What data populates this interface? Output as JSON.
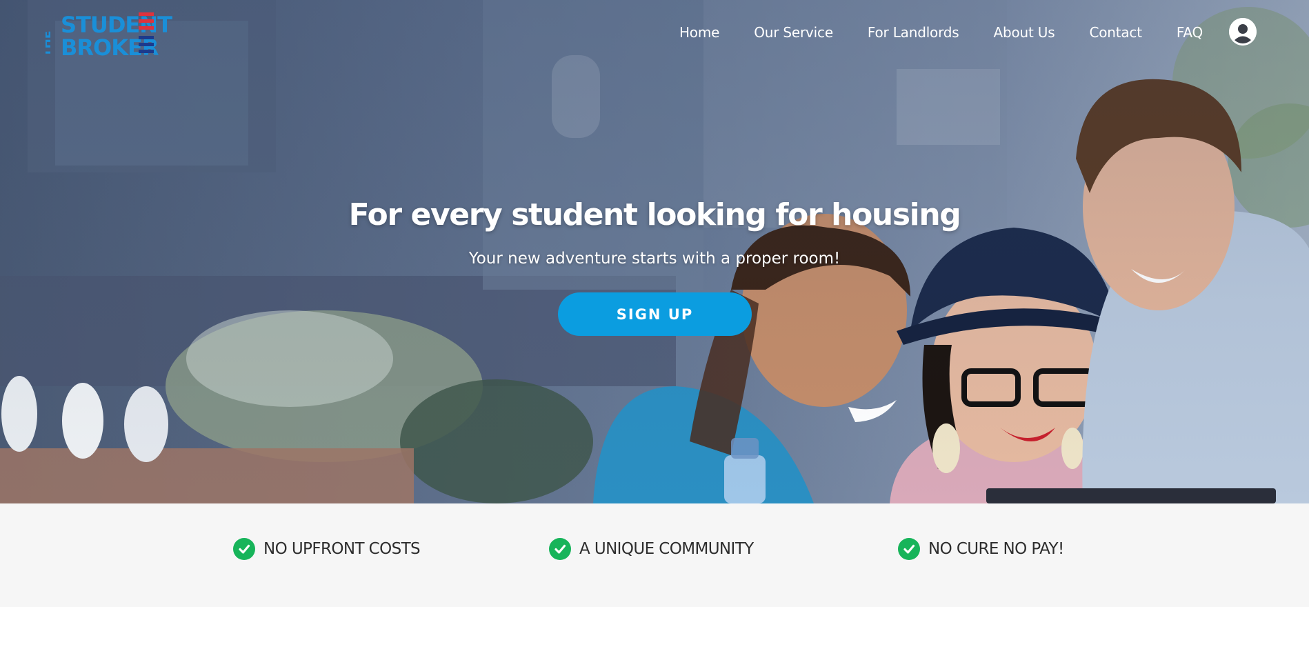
{
  "brand": {
    "logo_the": "THE",
    "logo_student": "STUDENT",
    "logo_broker": "BROKER"
  },
  "nav": {
    "items": [
      "Home",
      "Our Service",
      "For Landlords",
      "About Us",
      "Contact",
      "FAQ"
    ]
  },
  "hero": {
    "title": "For every student looking for housing",
    "subtitle": "Your new adventure starts with a proper room!",
    "cta_label": "SIGN UP"
  },
  "features": [
    {
      "label": "NO UPFRONT COSTS",
      "icon": "check-circle-icon"
    },
    {
      "label": "A UNIQUE COMMUNITY",
      "icon": "check-circle-icon"
    },
    {
      "label": "NO CURE NO PAY!",
      "icon": "check-circle-icon"
    }
  ],
  "colors": {
    "brand_blue": "#1a8fd8",
    "brand_red": "#e0323c",
    "brand_navy": "#1c3a8c",
    "cta_blue": "#0b9de0",
    "check_green": "#17b45a",
    "features_bg": "#f6f6f6"
  }
}
